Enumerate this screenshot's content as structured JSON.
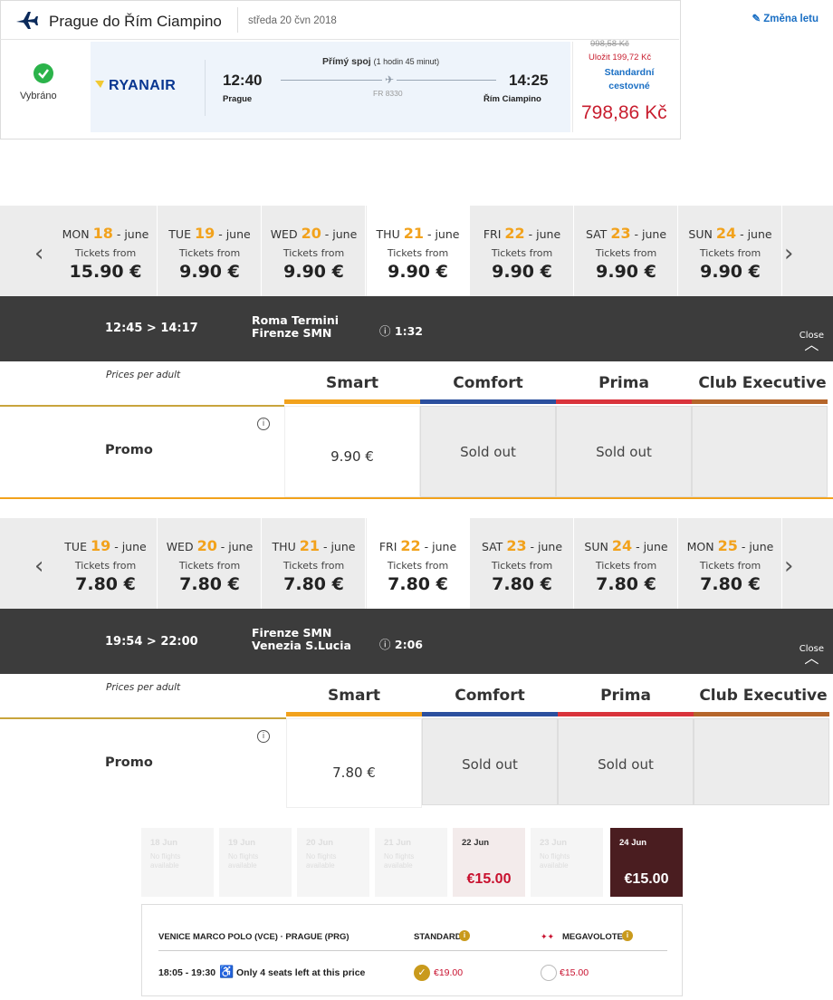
{
  "flight": {
    "route": "Prague do Řím Ciampino",
    "date": "středa 20 čvn 2018",
    "change_label": "Změna letu",
    "status": "Vybráno",
    "airline": "RYANAIR",
    "departure_time": "12:40",
    "departure_city": "Prague",
    "arrival_time": "14:25",
    "arrival_city": "Řím Ciampino",
    "direct_label": "Přímý spoj",
    "duration": "(1 hodin 45 minut)",
    "flight_number": "FR 8330",
    "old_price": "998,58 Kč",
    "savings": "Uložit 199,72 Kč",
    "fare_type_line1": "Standardní",
    "fare_type_line2": "cestovné",
    "price": "798,86 Kč"
  },
  "strip1": {
    "days": [
      {
        "dow": "MON",
        "num": "18",
        "month": " - june",
        "from": "Tickets from",
        "price": "15.90 €"
      },
      {
        "dow": "TUE",
        "num": "19",
        "month": " - june",
        "from": "Tickets from",
        "price": "9.90 €"
      },
      {
        "dow": "WED",
        "num": "20",
        "month": " - june",
        "from": "Tickets from",
        "price": "9.90 €"
      },
      {
        "dow": "THU",
        "num": "21",
        "month": " - june",
        "from": "Tickets from",
        "price": "9.90 €"
      },
      {
        "dow": "FRI",
        "num": "22",
        "month": " - june",
        "from": "Tickets from",
        "price": "9.90 €"
      },
      {
        "dow": "SAT",
        "num": "23",
        "month": " - june",
        "from": "Tickets from",
        "price": "9.90 €"
      },
      {
        "dow": "SUN",
        "num": "24",
        "month": " - june",
        "from": "Tickets from",
        "price": "9.90 €"
      }
    ]
  },
  "train1": {
    "times": "12:45 > 14:17",
    "from": "Roma Termini",
    "to": "Firenze SMN",
    "duration": "1:32",
    "close": "Close"
  },
  "fare1": {
    "prices_per_adult": "Prices per adult",
    "columns": [
      "Smart",
      "Comfort",
      "Prima",
      "Club Executive"
    ],
    "row_label": "Promo",
    "smart": "9.90 €",
    "comfort": "Sold out",
    "prima": "Sold out",
    "club": ""
  },
  "strip2": {
    "days": [
      {
        "dow": "TUE",
        "num": "19",
        "month": " - june",
        "from": "Tickets from",
        "price": "7.80 €"
      },
      {
        "dow": "WED",
        "num": "20",
        "month": " - june",
        "from": "Tickets from",
        "price": "7.80 €"
      },
      {
        "dow": "THU",
        "num": "21",
        "month": " - june",
        "from": "Tickets from",
        "price": "7.80 €"
      },
      {
        "dow": "FRI",
        "num": "22",
        "month": " - june",
        "from": "Tickets from",
        "price": "7.80 €"
      },
      {
        "dow": "SAT",
        "num": "23",
        "month": " - june",
        "from": "Tickets from",
        "price": "7.80 €"
      },
      {
        "dow": "SUN",
        "num": "24",
        "month": " - june",
        "from": "Tickets from",
        "price": "7.80 €"
      },
      {
        "dow": "MON",
        "num": "25",
        "month": " - june",
        "from": "Tickets from",
        "price": "7.80 €"
      }
    ]
  },
  "train2": {
    "times": "19:54 > 22:00",
    "from": "Firenze SMN",
    "to": "Venezia S.Lucia",
    "duration": "2:06",
    "close": "Close"
  },
  "fare2": {
    "prices_per_adult": "Prices per adult",
    "columns": [
      "Smart",
      "Comfort",
      "Prima",
      "Club Executive"
    ],
    "row_label": "Promo",
    "smart": "7.80 €",
    "comfort": "Sold out",
    "prima": "Sold out",
    "club": ""
  },
  "volotea": {
    "days": [
      {
        "date": "18 Jun",
        "note1": "No flights",
        "note2": "available",
        "price": ""
      },
      {
        "date": "19 Jun",
        "note1": "No flights",
        "note2": "available",
        "price": ""
      },
      {
        "date": "20 Jun",
        "note1": "No flights",
        "note2": "available",
        "price": ""
      },
      {
        "date": "21 Jun",
        "note1": "No flights",
        "note2": "available",
        "price": ""
      },
      {
        "date": "22 Jun",
        "note1": "",
        "note2": "",
        "price": "€15.00"
      },
      {
        "date": "23 Jun",
        "note1": "No flights",
        "note2": "available",
        "price": ""
      },
      {
        "date": "24 Jun",
        "note1": "",
        "note2": "",
        "price": "€15.00"
      }
    ],
    "route": "VENICE MARCO POLO (VCE) · PRAGUE (PRG)",
    "standard": "STANDARD",
    "megavolotea": "MEGAVOLOTEA",
    "times": "18:05 - 19:30",
    "seats": "Only 4 seats left at this price",
    "standard_price": "€19.00",
    "mega_price": "€15.00"
  },
  "colors": {
    "smart": "#f2a21c",
    "comfort": "#2b4f9e",
    "prima": "#d9333b",
    "club": "#b5652a",
    "volotea_selected": "#4a1d20",
    "volotea_red": "#c8102e"
  }
}
